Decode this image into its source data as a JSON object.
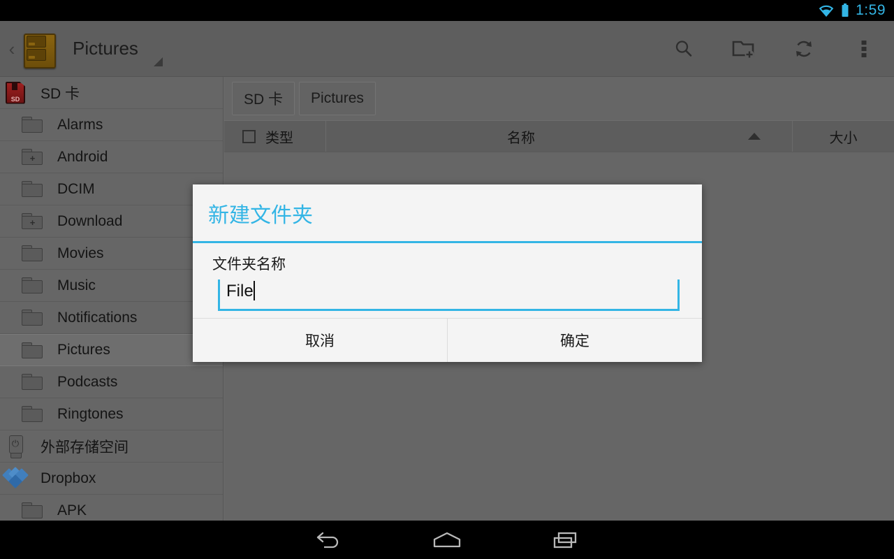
{
  "status_bar": {
    "clock": "1:59",
    "wifi_icon": "wifi-icon",
    "battery_icon": "battery-icon",
    "accent_color": "#33b5e5"
  },
  "action_bar": {
    "back_chevron": "‹",
    "app_icon": "file-cabinet-icon",
    "title": "Pictures",
    "dropdown_icon": "dropdown-triangle-icon",
    "actions": [
      {
        "name": "search-icon",
        "label": "Search"
      },
      {
        "name": "new-folder-icon",
        "label": "New folder"
      },
      {
        "name": "refresh-icon",
        "label": "Refresh"
      },
      {
        "name": "overflow-menu-icon",
        "label": "More options"
      }
    ]
  },
  "sidebar": {
    "items": [
      {
        "label": "SD 卡",
        "icon": "sd-card-icon",
        "indent": false,
        "selected": false,
        "expandable": false
      },
      {
        "label": "Alarms",
        "icon": "folder-icon",
        "indent": true,
        "selected": false,
        "expandable": false
      },
      {
        "label": "Android",
        "icon": "folder-expandable-icon",
        "indent": true,
        "selected": false,
        "expandable": true
      },
      {
        "label": "DCIM",
        "icon": "folder-icon",
        "indent": true,
        "selected": false,
        "expandable": false
      },
      {
        "label": "Download",
        "icon": "folder-expandable-icon",
        "indent": true,
        "selected": false,
        "expandable": true
      },
      {
        "label": "Movies",
        "icon": "folder-icon",
        "indent": true,
        "selected": false,
        "expandable": false
      },
      {
        "label": "Music",
        "icon": "folder-icon",
        "indent": true,
        "selected": false,
        "expandable": false
      },
      {
        "label": "Notifications",
        "icon": "folder-icon",
        "indent": true,
        "selected": false,
        "expandable": false
      },
      {
        "label": "Pictures",
        "icon": "folder-icon",
        "indent": true,
        "selected": true,
        "expandable": false
      },
      {
        "label": "Podcasts",
        "icon": "folder-icon",
        "indent": true,
        "selected": false,
        "expandable": false
      },
      {
        "label": "Ringtones",
        "icon": "folder-icon",
        "indent": true,
        "selected": false,
        "expandable": false
      },
      {
        "label": "外部存储空间",
        "icon": "usb-drive-icon",
        "indent": false,
        "selected": false,
        "expandable": false
      },
      {
        "label": "Dropbox",
        "icon": "dropbox-icon",
        "indent": false,
        "selected": false,
        "expandable": false
      },
      {
        "label": "APK",
        "icon": "folder-icon",
        "indent": true,
        "selected": false,
        "expandable": false
      }
    ]
  },
  "content": {
    "breadcrumbs": [
      {
        "label": "SD 卡"
      },
      {
        "label": "Pictures"
      }
    ],
    "columns": {
      "type": "类型",
      "name": "名称",
      "size": "大小",
      "sort_icon": "sort-ascending-icon",
      "select_all_checkbox": "select-all-checkbox"
    },
    "rows": []
  },
  "dialog": {
    "title": "新建文件夹",
    "field_label": "文件夹名称",
    "field_value": "File",
    "field_placeholder": "",
    "cancel_label": "取消",
    "confirm_label": "确定",
    "accent_color": "#33b5e5"
  },
  "nav_bar": {
    "buttons": [
      {
        "name": "nav-back-icon",
        "label": "Back"
      },
      {
        "name": "nav-home-icon",
        "label": "Home"
      },
      {
        "name": "nav-recents-icon",
        "label": "Recents"
      }
    ]
  }
}
